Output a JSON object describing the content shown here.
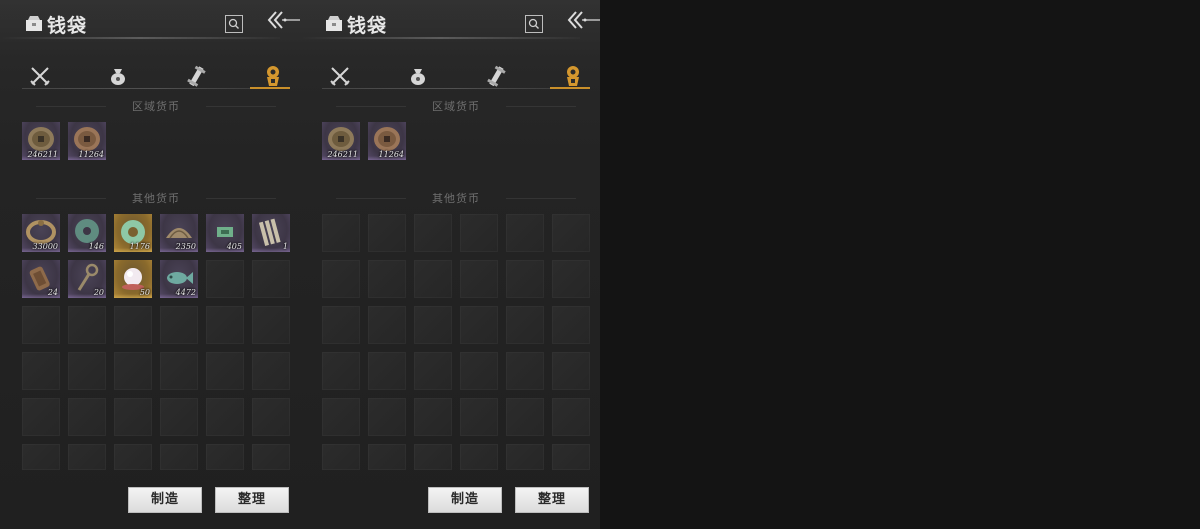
{
  "panels": [
    {
      "title": "钱袋",
      "sections": {
        "regional": "区域货币",
        "other": "其他货币"
      },
      "regional_items": [
        {
          "icon": "coin-icon",
          "count": "246211",
          "rarity": "purple"
        },
        {
          "icon": "coin-icon",
          "count": "11264",
          "rarity": "purple"
        }
      ],
      "other_items": [
        {
          "icon": "ring-icon",
          "count": "33000",
          "rarity": "purple"
        },
        {
          "icon": "jade-disc-icon",
          "count": "146",
          "rarity": "purple"
        },
        {
          "icon": "jade-ring-icon",
          "count": "1176",
          "rarity": "gold"
        },
        {
          "icon": "shell-icon",
          "count": "2350",
          "rarity": "purple"
        },
        {
          "icon": "jade-bar-icon",
          "count": "405",
          "rarity": "purple"
        },
        {
          "icon": "bamboo-slips-icon",
          "count": "1",
          "rarity": "purple"
        },
        {
          "icon": "bronze-block-icon",
          "count": "24",
          "rarity": "purple"
        },
        {
          "icon": "key-icon",
          "count": "20",
          "rarity": "purple"
        },
        {
          "icon": "pearl-icon",
          "count": "50",
          "rarity": "gold"
        },
        {
          "icon": "jade-fish-icon",
          "count": "4472",
          "rarity": "purple"
        }
      ],
      "buttons": {
        "craft": "制造",
        "sort": "整理"
      }
    },
    {
      "title": "钱袋",
      "sections": {
        "regional": "区域货币",
        "other": "其他货币"
      },
      "regional_items": [
        {
          "icon": "coin-icon",
          "count": "246211",
          "rarity": "purple"
        },
        {
          "icon": "coin-icon",
          "count": "11264",
          "rarity": "purple"
        }
      ],
      "other_items": [],
      "buttons": {
        "craft": "制造",
        "sort": "整理"
      }
    }
  ],
  "tabs": [
    "swords-icon",
    "money-bag-icon",
    "scroll-icon",
    "coin-tab-icon"
  ],
  "colors": {
    "accent": "#c98f2a",
    "rarity_purple": "#564a68",
    "rarity_gold": "#b38a3a"
  }
}
